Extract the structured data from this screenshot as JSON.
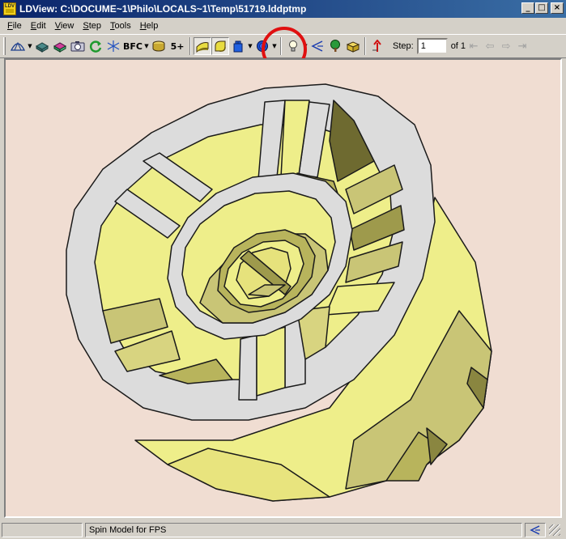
{
  "window": {
    "icon_label": "LDV",
    "title": "LDView: C:\\DOCUME~1\\Philo\\LOCALS~1\\Temp\\51719.lddptmp",
    "minimize": "_",
    "maximize": "□",
    "close": "×"
  },
  "menu": [
    {
      "ul": "F",
      "rest": "ile"
    },
    {
      "ul": "E",
      "rest": "dit"
    },
    {
      "ul": "V",
      "rest": "iew"
    },
    {
      "ul": "S",
      "rest": "tep"
    },
    {
      "ul": "T",
      "rest": "ools"
    },
    {
      "ul": "H",
      "rest": "elp"
    }
  ],
  "toolbar": {
    "bfc_label": "BFC",
    "lod_label": "5+",
    "step_label": "Step:",
    "step_value": "1",
    "of_label": "of 1"
  },
  "icons": {
    "wireframe": "wireframe-icon",
    "seams": "seams-icon",
    "edges": "edge-lines-icon",
    "screenshot": "camera-icon",
    "reload": "reload-icon",
    "axes": "axes-icon",
    "bfc": "bfc-icon",
    "primitive": "primitive-substitution-icon",
    "lod": "level-of-detail-icon",
    "lighting": "lighting-icon",
    "smooth": "smooth-curves-icon",
    "part_bounding": "part-bounding-box-icon",
    "studs": "stud-quality-icon",
    "viewing_angle": "viewing-angle-icon",
    "preferences": "preferences-icon",
    "tree": "model-tree-icon",
    "bounding": "bounding-box-icon",
    "poll": "mpd-icon",
    "first": "first-step-icon",
    "prev": "previous-step-icon",
    "next": "next-step-icon",
    "last": "last-step-icon"
  },
  "colors": {
    "part_yellow": "#eeee8a",
    "part_shade": "#b8b45c",
    "rim_gray": "#dcdcdc",
    "background": "#f0ddd2",
    "highlight": "#e01010"
  },
  "status": {
    "progress": "",
    "message": "Spin Model for FPS"
  }
}
